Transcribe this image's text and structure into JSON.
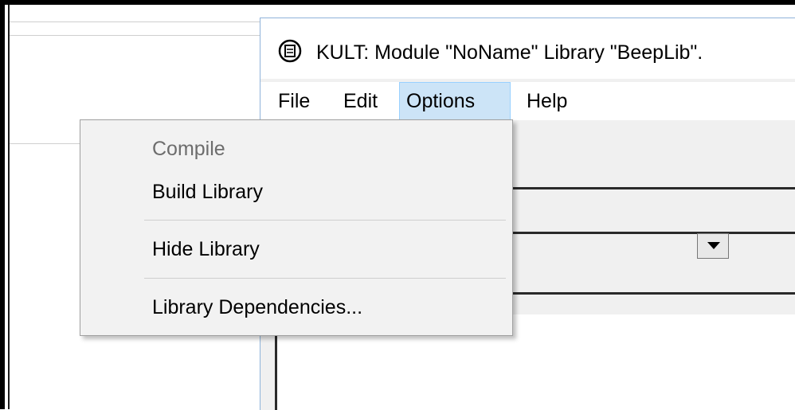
{
  "window": {
    "title": "KULT: Module \"NoName\" Library \"BeepLib\".",
    "icon": "kult-app-icon"
  },
  "menubar": {
    "items": [
      {
        "label": "File"
      },
      {
        "label": "Edit"
      },
      {
        "label": "Options",
        "active": true
      },
      {
        "label": "Help"
      }
    ]
  },
  "options_menu": {
    "items": [
      {
        "label": "Compile",
        "enabled": false
      },
      {
        "label": "Build Library",
        "enabled": true
      },
      {
        "label": "Hide Library",
        "enabled": true
      },
      {
        "label": "Library Dependencies...",
        "enabled": true
      }
    ]
  },
  "colors": {
    "menu_active_bg": "#cce4f7",
    "menu_bg": "#f2f2f2",
    "disabled_text": "#6d6d6d"
  }
}
